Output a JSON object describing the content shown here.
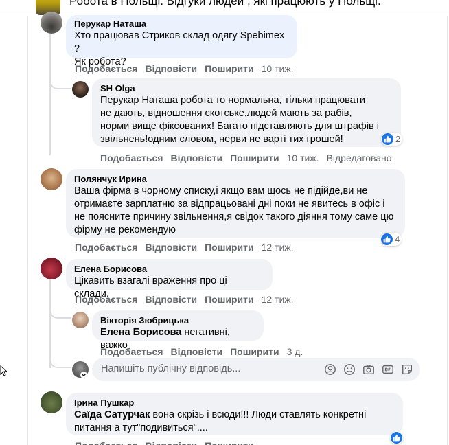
{
  "header": {
    "title": "Робота в Польщі. Відгуки людей , які працюють у Польщі."
  },
  "actions": {
    "like": "Подобається",
    "reply": "Відповісти",
    "share": "Поширити"
  },
  "comments": [
    {
      "author": "Перукар Наташа",
      "lines": [
        "Хто працював Стриков склад одягу Spebimex ?",
        "Як робота?"
      ],
      "time": "10 тиж."
    },
    {
      "author": "SH Olga",
      "lines": [
        "Перукар Наташа робота то нормальна, тільки працювати",
        "не дають, відношення скотське,людей мають за рабів,",
        "норми вище фіксованих! Багато підставляють для штрафів і",
        "звільнень!одним словом, нерви не варті тих грошей!"
      ],
      "time": "10 тиж.",
      "edited": "Відредаговано",
      "likes": "2"
    },
    {
      "author": "Полянчук Ирина",
      "lines": [
        "Ваша фірма в чорному списку,і якщо вам щось не підійде,ви не",
        "отримаєте зарплатню за відпрацьовані дні поки не явитесь в офіс і",
        "не поясните причину звільнення,я свідок такого діяння тому саме цю",
        "фірму не рекомендую"
      ],
      "time": "12 тиж.",
      "likes": "4"
    },
    {
      "author": "Елена Борисова",
      "lines": [
        "Цікавить взагалі враження про ці склади."
      ],
      "time": "12 тиж."
    },
    {
      "author": "Вікторія Зюбрицька",
      "mention": "Елена Борисова",
      "text": " негативні, важко",
      "time": "3 д."
    },
    {
      "author": "Ірина Пушкар",
      "mention": "Саїда Сатурчак",
      "text_line1": " вона скрізь і всюди!!! Люди ставлять конкретні",
      "text_line2": "питання а тут\"подивиться\"...."
    }
  ],
  "reply_box": {
    "placeholder": "Напишіть публічну відповідь..."
  },
  "colors": {
    "like_blue": "#1b74e4",
    "bubble": "#f0f2f5",
    "highlight": "#ebf2fd",
    "muted": "#65676b"
  },
  "icons": [
    "like-icon",
    "emoji-icon",
    "camera-icon",
    "gif-icon",
    "sticker-icon",
    "cursor-icon"
  ]
}
